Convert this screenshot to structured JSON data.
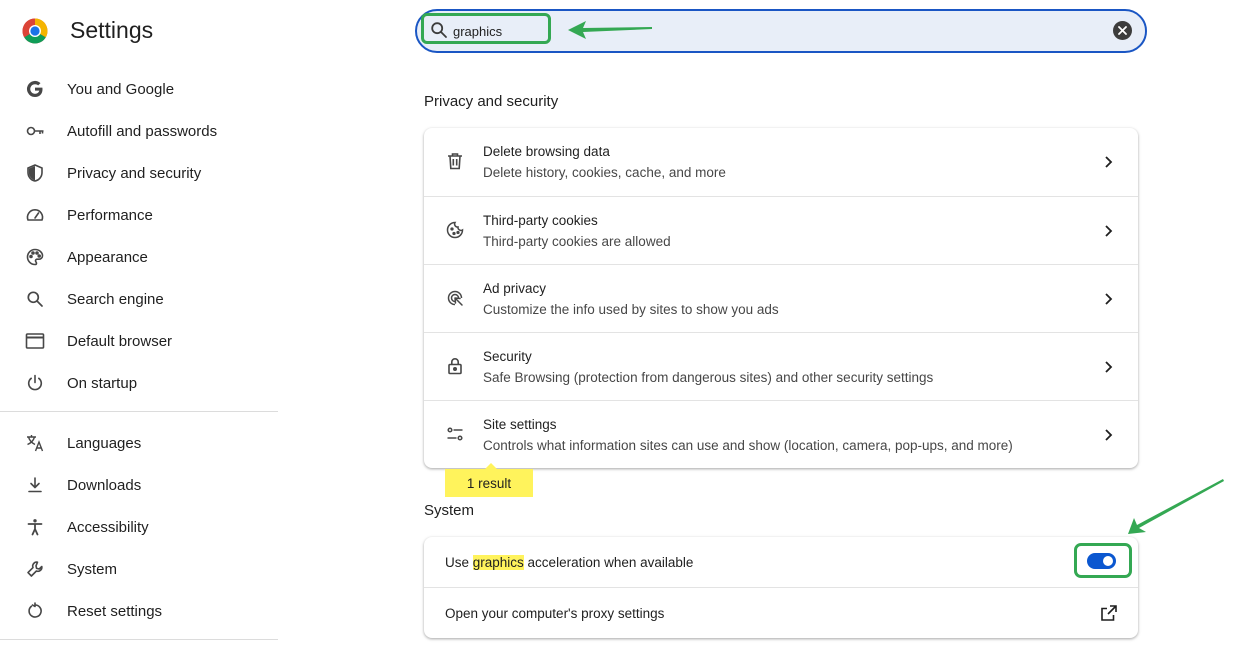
{
  "app": {
    "title": "Settings",
    "logo_icon": "chrome-logo-icon"
  },
  "sidebar": {
    "items": [
      {
        "label": "You and Google",
        "icon": "google-g-icon"
      },
      {
        "label": "Autofill and passwords",
        "icon": "key-icon"
      },
      {
        "label": "Privacy and security",
        "icon": "shield-icon"
      },
      {
        "label": "Performance",
        "icon": "speedometer-icon"
      },
      {
        "label": "Appearance",
        "icon": "palette-icon"
      },
      {
        "label": "Search engine",
        "icon": "search-icon"
      },
      {
        "label": "Default browser",
        "icon": "browser-window-icon"
      },
      {
        "label": "On startup",
        "icon": "power-icon"
      },
      {
        "label": "Languages",
        "icon": "translate-icon"
      },
      {
        "label": "Downloads",
        "icon": "download-icon"
      },
      {
        "label": "Accessibility",
        "icon": "accessibility-icon"
      },
      {
        "label": "System",
        "icon": "wrench-icon"
      },
      {
        "label": "Reset settings",
        "icon": "reset-icon"
      }
    ]
  },
  "search": {
    "value": "graphics"
  },
  "privacy": {
    "title": "Privacy and security",
    "rows": [
      {
        "title": "Delete browsing data",
        "subtitle": "Delete history, cookies, cache, and more",
        "icon": "trash-icon"
      },
      {
        "title": "Third-party cookies",
        "subtitle": "Third-party cookies are allowed",
        "icon": "cookie-icon"
      },
      {
        "title": "Ad privacy",
        "subtitle": "Customize the info used by sites to show you ads",
        "icon": "ad-privacy-icon"
      },
      {
        "title": "Security",
        "subtitle": "Safe Browsing (protection from dangerous sites) and other security settings",
        "icon": "lock-icon"
      },
      {
        "title": "Site settings",
        "subtitle": "Controls what information sites can use and show (location, camera, pop-ups, and more)",
        "icon": "site-settings-icon"
      }
    ],
    "result_badge": "1 result"
  },
  "system": {
    "title": "System",
    "graphics_row": {
      "prefix": "Use ",
      "highlight": "graphics",
      "suffix": " acceleration when available",
      "enabled": true
    },
    "proxy_row": {
      "label": "Open your computer's proxy settings",
      "icon": "external-link-icon"
    }
  },
  "colors": {
    "accent": "#0b57d0",
    "annotation_green": "#34a853",
    "highlight_yellow": "#fff35c"
  }
}
